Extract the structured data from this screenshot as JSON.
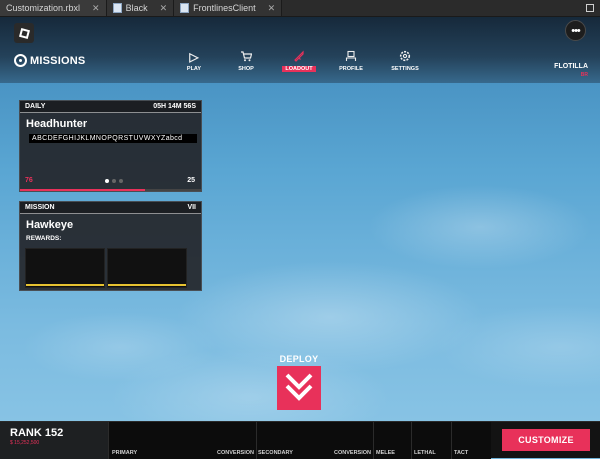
{
  "tabs": [
    {
      "label": "Customization.rbxl",
      "close": "✕"
    },
    {
      "label": "Black",
      "close": "✕"
    },
    {
      "label": "FrontlinesClient",
      "close": "✕"
    }
  ],
  "menu_icon": "ellipsis-icon",
  "brand": {
    "label": "MISSIONS"
  },
  "nav": {
    "play": "PLAY",
    "shop": "SHOP",
    "loadout": "LOADOUT",
    "profile": "PROFILE",
    "settings": "SETTINGS"
  },
  "flotilla": {
    "label": "FLOTILLA",
    "sub": "BR"
  },
  "daily": {
    "header": "DAILY",
    "timer": "05H 14M 56S",
    "title": "Headhunter",
    "text": "ABCDEFGHIJKLMNOPQRSTUVWXYZabcd",
    "progress_label": "76",
    "target": "25",
    "progress_fraction": 0.69,
    "page": 1,
    "page_count": 3
  },
  "mission": {
    "header": "MISSION",
    "level": "VII",
    "title": "Hawkeye",
    "rewards_label": "REWARDS:"
  },
  "deploy": {
    "label": "DEPLOY"
  },
  "rank": {
    "label": "RANK 152",
    "money": "$ 15,252,500"
  },
  "slots": {
    "primary": "PRIMARY",
    "conversion1": "CONVERSION",
    "secondary": "SECONDARY",
    "conversion2": "CONVERSION",
    "melee": "MELEE",
    "lethal": "LETHAL",
    "tact": "TACT"
  },
  "customize": "CUSTOMIZE",
  "colors": {
    "accent": "#e8315a",
    "reward_line": "#e6c231"
  }
}
